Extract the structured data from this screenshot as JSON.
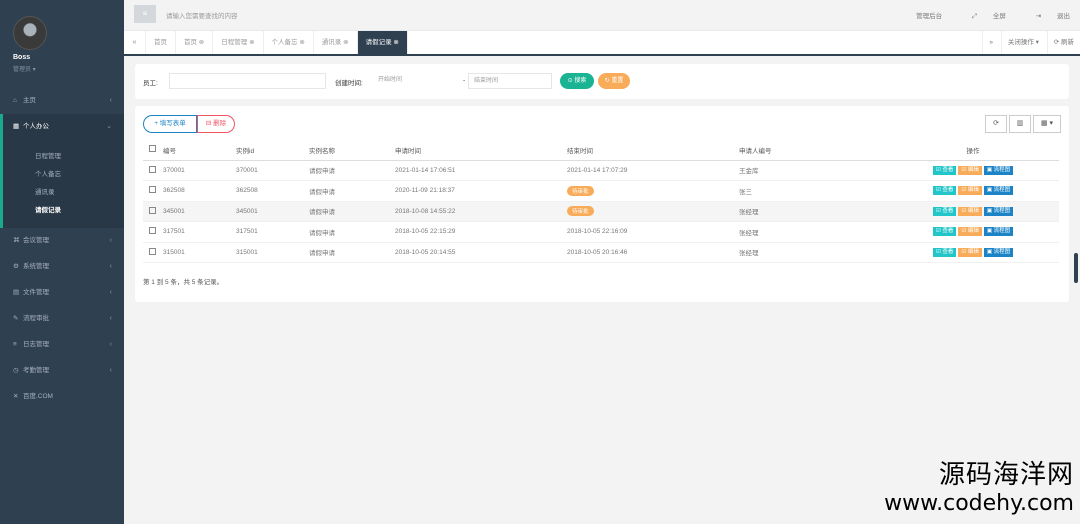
{
  "sidebar": {
    "user_name": "Boss",
    "user_role": "管理员 ▾",
    "items": [
      {
        "label": "主页",
        "icon": "home-icon",
        "glyph": "⌂"
      },
      {
        "label": "个人办公",
        "icon": "calendar-icon",
        "glyph": "▦"
      },
      {
        "label": "会议管理",
        "icon": "meeting-icon",
        "glyph": "⌘"
      },
      {
        "label": "系统管理",
        "icon": "gear-icon",
        "glyph": "⚙"
      },
      {
        "label": "文件管理",
        "icon": "file-icon",
        "glyph": "▤"
      },
      {
        "label": "流程审批",
        "icon": "wrench-icon",
        "glyph": "✎"
      },
      {
        "label": "日志管理",
        "icon": "list-icon",
        "glyph": "≡"
      },
      {
        "label": "考勤管理",
        "icon": "clock-icon",
        "glyph": "◷"
      },
      {
        "label": "百度.COM",
        "icon": "close-icon",
        "glyph": "✕"
      }
    ],
    "subitems": [
      "日程管理",
      "个人备忘",
      "通讯录",
      "请假记录"
    ]
  },
  "topbar": {
    "menu_glyph": "≡",
    "search_placeholder": "请输入您需要查找的内容",
    "right": [
      "管理后台",
      "全屏",
      "退出"
    ]
  },
  "tabs": [
    "首页",
    "首页 ⊗",
    "日程管理 ⊗",
    "个人备忘 ⊗",
    "通讯录 ⊗",
    "请假记录 ⊗"
  ],
  "tab_ops": {
    "more": "关闭操作 ▾",
    "refresh": "⟳ 刷新"
  },
  "search": {
    "employee_label": "员工:",
    "created_label": "创建时间:",
    "start_ph": "开始时间",
    "sep": "-",
    "end_ph": "结束时间",
    "search_btn": "⊙ 搜索",
    "reset_btn": "↻ 重置"
  },
  "table": {
    "add_btn": "+ 填写表单",
    "del_btn": "⊟ 删除",
    "tools": [
      "⟳",
      "▥",
      "▦ ▾"
    ],
    "headers": [
      "",
      "编号",
      "实例id",
      "实例名称",
      "申请时间",
      "结束时间",
      "申请人编号",
      "操作"
    ],
    "rows": [
      {
        "id": "370001",
        "inst": "370001",
        "name": "请假申请",
        "apply": "2021-01-14 17:06:51",
        "end": "2021-01-14 17:07:29",
        "end_badge": "",
        "applicant": "王金库"
      },
      {
        "id": "362508",
        "inst": "362508",
        "name": "请假申请",
        "apply": "2020-11-09 21:18:37",
        "end": "",
        "end_badge": "待审批",
        "applicant": "张三"
      },
      {
        "id": "345001",
        "inst": "345001",
        "name": "请假申请",
        "apply": "2018-10-08 14:55:22",
        "end": "",
        "end_badge": "待审批",
        "applicant": "张经理"
      },
      {
        "id": "317501",
        "inst": "317501",
        "name": "请假申请",
        "apply": "2018-10-05 22:15:29",
        "end": "2018-10-05 22:16:09",
        "end_badge": "",
        "applicant": "张经理"
      },
      {
        "id": "315001",
        "inst": "315001",
        "name": "请假申请",
        "apply": "2018-10-05 20:14:55",
        "end": "2018-10-05 20:16:46",
        "end_badge": "",
        "applicant": "张经理"
      }
    ],
    "ops": [
      "☑ 查看",
      "☑ 编辑",
      "▣ 流程图"
    ],
    "pager": "第 1 到 5 条，共 5 条记录。"
  },
  "watermark": {
    "line1": "源码海洋网",
    "line2": "www.codehy.com"
  },
  "colors": {
    "sidebar": "#2f4050",
    "accent": "#1ab394",
    "warning": "#f8ac59",
    "primary": "#1c84c6",
    "danger": "#ed5565"
  }
}
